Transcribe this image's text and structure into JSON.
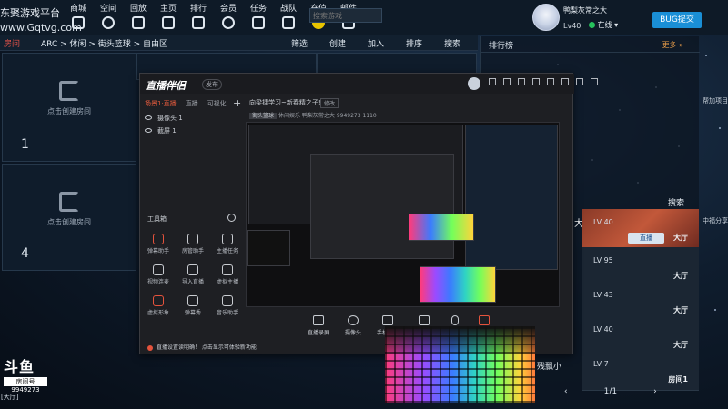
{
  "brand": {
    "name": "东聚游戏平台",
    "url": "www.Gqtvg.com"
  },
  "topnav": [
    "商城",
    "空间",
    "回放",
    "主页",
    "排行",
    "会员",
    "任务",
    "战队",
    "充值",
    "邮件"
  ],
  "search": {
    "placeholder": "搜索游戏"
  },
  "user": {
    "name": "鸭梨灰常之大",
    "level": "Lv40",
    "status": "在线"
  },
  "bug_button": "BUG提交",
  "crumbbar": {
    "room_tag": "房间",
    "path": "ARC > 休闲 > 街头篮球 > 自由区",
    "actions": [
      "筛选",
      "创建",
      "加入",
      "排序",
      "搜索"
    ]
  },
  "room_cells": [
    {
      "text": "点击创建房间",
      "num": "1"
    },
    {
      "text": "点击创建房间",
      "num": "4"
    }
  ],
  "ranking": {
    "title": "排行榜",
    "more": "更多 »"
  },
  "room_list": {
    "search_label": "搜索",
    "big_char": "大",
    "rows": [
      {
        "level": "LV 40",
        "hall": "大厅",
        "live": "直播"
      },
      {
        "level": "LV 95",
        "hall": "大厅"
      },
      {
        "level": "LV 43",
        "hall": "大厅"
      },
      {
        "level": "LV 40",
        "hall": "大厅"
      },
      {
        "level": "LV 7",
        "hall": "房间1"
      }
    ],
    "pager": "1/1"
  },
  "side_texts": [
    "帮加项目",
    "中福分享"
  ],
  "side_fragment": "残飘小",
  "app": {
    "logo": "直播伴侣",
    "version": "发布",
    "tabs": [
      "场景1·直播",
      "直播",
      "可视化"
    ],
    "sources": [
      "摄像头 1",
      "截屏 1"
    ],
    "toolbox_label": "工具箱",
    "tools": [
      "弹幕助手",
      "房管助手",
      "主播任务",
      "视频连麦",
      "导入直播",
      "虚拟主播",
      "虚拟形象",
      "弹幕秀",
      "音乐助手"
    ],
    "stream_title": "向梁捷学习~新春精之子!",
    "mod_btn": "修改",
    "stream_info": {
      "tag": "街头篮球",
      "category": "休闲娱乐",
      "user": "鸭梨灰常之大",
      "room": "9949273",
      "viewers": "1110"
    },
    "tip": "直播设置读明确！ 点击显示可体验新功能",
    "bottom_buttons": [
      "直播录屏",
      "摄像头",
      "手机投屏"
    ]
  },
  "douyu": {
    "logo": "斗鱼",
    "room_label": "房间号",
    "room_id": "9949273"
  },
  "corner_label": "[大厅]"
}
